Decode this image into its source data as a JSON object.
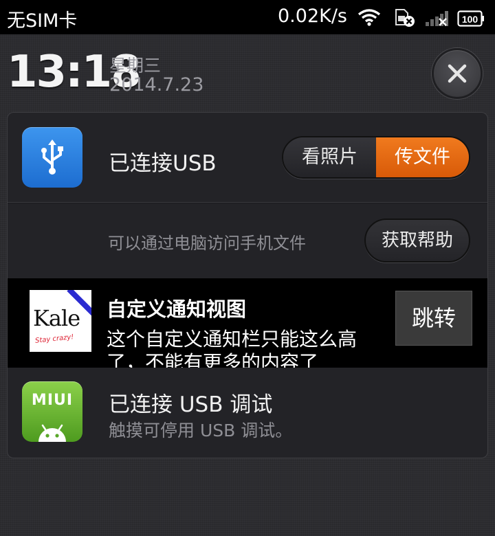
{
  "status_bar": {
    "carrier": "无SIM卡",
    "net_speed": "0.02K/s",
    "battery": "100",
    "icons": [
      "wifi-icon",
      "sim-card-icon",
      "signal-icon",
      "battery-icon"
    ]
  },
  "header": {
    "time": "13:18",
    "weekday": "星期三",
    "date": "2014.7.23",
    "close_icon": "close-icon"
  },
  "usb_notification": {
    "title": "已连接USB",
    "mode_photos": "看照片",
    "mode_files": "传文件",
    "description": "可以通过电脑访问手机文件",
    "help_button": "获取帮助",
    "icon": "usb-icon",
    "accent_color": "#e8670f"
  },
  "custom_notification": {
    "title": "自定义通知视图",
    "body": "这个自定义通知栏只能这么高了，不能有更多的内容了",
    "button": "跳转",
    "logo_text": "Kale",
    "logo_tagline": "Stay crazy!"
  },
  "debug_notification": {
    "title": "已连接 USB 调试",
    "subtitle": "触摸可停用 USB 调试。",
    "icon_label": "MIUI",
    "icon": "android-icon"
  }
}
